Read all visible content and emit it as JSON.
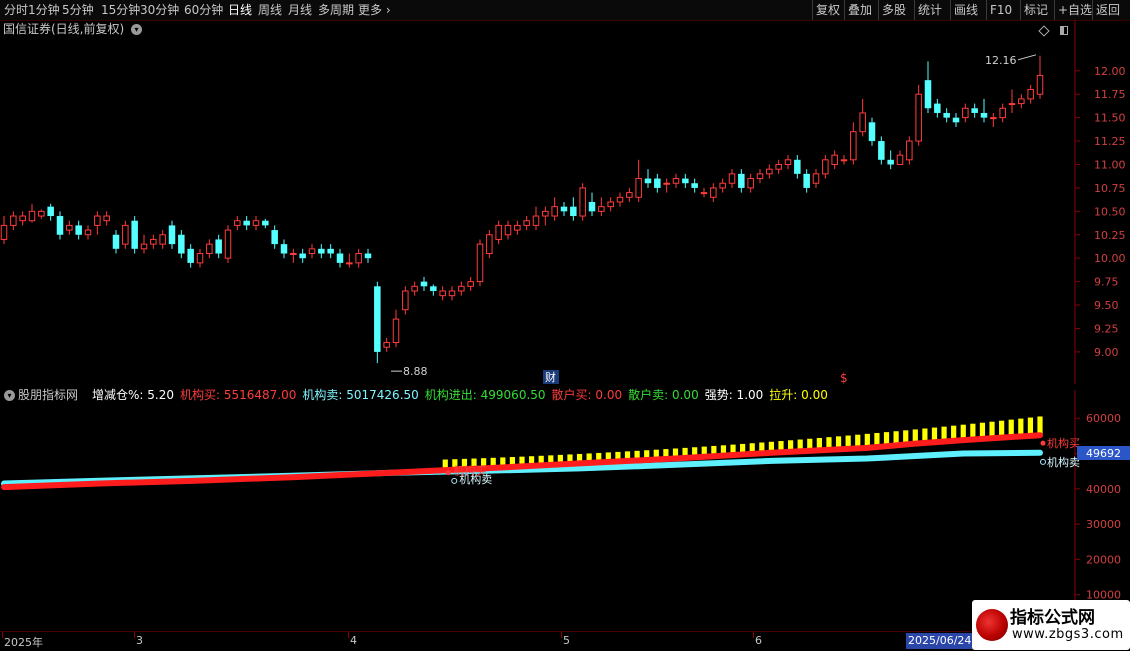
{
  "toolbar": {
    "left": [
      "分时",
      "1分钟",
      "5分钟",
      "15分钟",
      "30分钟",
      "60分钟",
      "日线",
      "周线",
      "月线",
      "多周期",
      "更多"
    ],
    "active": "日线",
    "right": [
      "复权",
      "叠加",
      "多股",
      "统计",
      "画线",
      "F10",
      "标记",
      "+自选",
      "返回"
    ]
  },
  "stock": {
    "title": "国信证券(日线,前复权)"
  },
  "price_chart": {
    "high_label": "12.16",
    "low_label": "8.88",
    "marker_cai": "财",
    "marker_s": "$"
  },
  "indicator": {
    "name": "股朋指标网",
    "items": [
      {
        "label": "增减仓%:",
        "value": "5.20",
        "color": "#ffffff"
      },
      {
        "label": "机构买:",
        "value": "5516487.00",
        "color": "#ff3c3c"
      },
      {
        "label": "机构卖:",
        "value": "5017426.50",
        "color": "#7ff5ff"
      },
      {
        "label": "机构进出:",
        "value": "499060.50",
        "color": "#33dd33"
      },
      {
        "label": "散户买:",
        "value": "0.00",
        "color": "#ff3c3c"
      },
      {
        "label": "散户卖:",
        "value": "0.00",
        "color": "#33dd33"
      },
      {
        "label": "强势:",
        "value": "1.00",
        "color": "#ffffff"
      },
      {
        "label": "拉升:",
        "value": "0.00",
        "color": "#ffff00"
      }
    ],
    "buy_label": "机构买",
    "sell_label": "机构卖",
    "value_box": "49692"
  },
  "date_axis": {
    "labels": [
      "2025年",
      "3",
      "4",
      "5",
      "6"
    ],
    "cursor_date": "2025/06/24"
  },
  "watermark": {
    "title": "指标公式网",
    "url": "www.zbgs3.com"
  },
  "colors": {
    "up": "#ff3c3c",
    "down": "#54ffff",
    "buy": "#ff1c1c",
    "sell": "#5ef0ff",
    "bar": "#ffff00",
    "axis": "#d04040"
  },
  "chart_data": [
    {
      "type": "candlestick",
      "title": "国信证券(日线,前复权)",
      "ylim": [
        8.7,
        12.35
      ],
      "yticks": [
        9.0,
        9.25,
        9.5,
        9.75,
        10.0,
        10.25,
        10.5,
        10.75,
        11.0,
        11.25,
        11.5,
        11.75,
        12.0
      ],
      "annotations": [
        {
          "text": "12.16",
          "value": 12.16
        },
        {
          "text": "8.88",
          "value": 8.88
        }
      ],
      "candles": [
        [
          10.2,
          10.35,
          10.45,
          10.15
        ],
        [
          10.35,
          10.45,
          10.5,
          10.3
        ],
        [
          10.4,
          10.45,
          10.5,
          10.35
        ],
        [
          10.4,
          10.5,
          10.58,
          10.38
        ],
        [
          10.45,
          10.5,
          10.52,
          10.42
        ],
        [
          10.55,
          10.45,
          10.58,
          10.4
        ],
        [
          10.45,
          10.25,
          10.5,
          10.2
        ],
        [
          10.3,
          10.35,
          10.4,
          10.25
        ],
        [
          10.35,
          10.25,
          10.4,
          10.2
        ],
        [
          10.25,
          10.3,
          10.35,
          10.2
        ],
        [
          10.35,
          10.45,
          10.5,
          10.25
        ],
        [
          10.4,
          10.45,
          10.5,
          10.35
        ],
        [
          10.25,
          10.1,
          10.3,
          10.05
        ],
        [
          10.15,
          10.35,
          10.4,
          10.1
        ],
        [
          10.4,
          10.1,
          10.45,
          10.05
        ],
        [
          10.1,
          10.15,
          10.25,
          10.05
        ],
        [
          10.15,
          10.2,
          10.25,
          10.1
        ],
        [
          10.15,
          10.25,
          10.3,
          10.1
        ],
        [
          10.35,
          10.15,
          10.4,
          10.1
        ],
        [
          10.25,
          10.05,
          10.3,
          10.0
        ],
        [
          10.1,
          9.95,
          10.15,
          9.9
        ],
        [
          9.95,
          10.05,
          10.1,
          9.9
        ],
        [
          10.05,
          10.15,
          10.2,
          10.0
        ],
        [
          10.2,
          10.05,
          10.25,
          10.0
        ],
        [
          10.0,
          10.3,
          10.35,
          9.95
        ],
        [
          10.35,
          10.4,
          10.45,
          10.3
        ],
        [
          10.4,
          10.35,
          10.45,
          10.3
        ],
        [
          10.35,
          10.4,
          10.45,
          10.3
        ],
        [
          10.4,
          10.35,
          10.42,
          10.32
        ],
        [
          10.3,
          10.15,
          10.35,
          10.1
        ],
        [
          10.15,
          10.05,
          10.2,
          10.0
        ],
        [
          10.05,
          10.05,
          10.1,
          9.95
        ],
        [
          10.05,
          10.0,
          10.1,
          9.95
        ],
        [
          10.05,
          10.1,
          10.15,
          10.0
        ],
        [
          10.1,
          10.05,
          10.15,
          10.0
        ],
        [
          10.1,
          10.05,
          10.15,
          10.0
        ],
        [
          10.05,
          9.95,
          10.1,
          9.9
        ],
        [
          9.95,
          9.95,
          10.05,
          9.9
        ],
        [
          9.95,
          10.05,
          10.1,
          9.9
        ],
        [
          10.05,
          10.0,
          10.1,
          9.95
        ],
        [
          9.7,
          9.0,
          9.75,
          8.88
        ],
        [
          9.05,
          9.1,
          9.15,
          9.0
        ],
        [
          9.1,
          9.35,
          9.45,
          9.05
        ],
        [
          9.45,
          9.65,
          9.7,
          9.4
        ],
        [
          9.65,
          9.7,
          9.75,
          9.6
        ],
        [
          9.75,
          9.7,
          9.8,
          9.65
        ],
        [
          9.7,
          9.65,
          9.72,
          9.6
        ],
        [
          9.6,
          9.65,
          9.7,
          9.55
        ],
        [
          9.6,
          9.65,
          9.7,
          9.55
        ],
        [
          9.65,
          9.7,
          9.75,
          9.6
        ],
        [
          9.7,
          9.75,
          9.8,
          9.65
        ],
        [
          9.75,
          10.15,
          10.2,
          9.7
        ],
        [
          10.05,
          10.25,
          10.3,
          10.0
        ],
        [
          10.2,
          10.35,
          10.4,
          10.15
        ],
        [
          10.25,
          10.35,
          10.4,
          10.2
        ],
        [
          10.3,
          10.35,
          10.4,
          10.25
        ],
        [
          10.35,
          10.4,
          10.45,
          10.3
        ],
        [
          10.35,
          10.45,
          10.55,
          10.3
        ],
        [
          10.45,
          10.5,
          10.55,
          10.35
        ],
        [
          10.45,
          10.55,
          10.65,
          10.4
        ],
        [
          10.55,
          10.5,
          10.6,
          10.45
        ],
        [
          10.55,
          10.45,
          10.65,
          10.4
        ],
        [
          10.45,
          10.75,
          10.8,
          10.4
        ],
        [
          10.6,
          10.5,
          10.7,
          10.45
        ],
        [
          10.5,
          10.55,
          10.65,
          10.45
        ],
        [
          10.55,
          10.6,
          10.65,
          10.5
        ],
        [
          10.6,
          10.65,
          10.7,
          10.55
        ],
        [
          10.65,
          10.7,
          10.75,
          10.6
        ],
        [
          10.65,
          10.85,
          11.05,
          10.6
        ],
        [
          10.85,
          10.8,
          10.95,
          10.75
        ],
        [
          10.85,
          10.75,
          10.9,
          10.7
        ],
        [
          10.8,
          10.8,
          10.85,
          10.7
        ],
        [
          10.8,
          10.85,
          10.9,
          10.75
        ],
        [
          10.85,
          10.8,
          10.9,
          10.75
        ],
        [
          10.8,
          10.75,
          10.85,
          10.7
        ],
        [
          10.7,
          10.7,
          10.75,
          10.65
        ],
        [
          10.65,
          10.75,
          10.8,
          10.6
        ],
        [
          10.75,
          10.8,
          10.85,
          10.7
        ],
        [
          10.8,
          10.9,
          10.95,
          10.75
        ],
        [
          10.9,
          10.75,
          10.95,
          10.7
        ],
        [
          10.75,
          10.85,
          10.9,
          10.7
        ],
        [
          10.85,
          10.9,
          10.95,
          10.8
        ],
        [
          10.9,
          10.95,
          11.0,
          10.85
        ],
        [
          10.95,
          11.0,
          11.05,
          10.9
        ],
        [
          11.0,
          11.05,
          11.1,
          10.95
        ],
        [
          11.05,
          10.9,
          11.1,
          10.85
        ],
        [
          10.9,
          10.75,
          10.95,
          10.7
        ],
        [
          10.8,
          10.9,
          10.95,
          10.75
        ],
        [
          10.9,
          11.05,
          11.1,
          10.85
        ],
        [
          11.0,
          11.1,
          11.15,
          10.95
        ],
        [
          11.05,
          11.05,
          11.1,
          11.0
        ],
        [
          11.05,
          11.35,
          11.45,
          11.0
        ],
        [
          11.35,
          11.55,
          11.7,
          11.3
        ],
        [
          11.45,
          11.25,
          11.5,
          11.2
        ],
        [
          11.25,
          11.05,
          11.3,
          11.0
        ],
        [
          11.05,
          11.0,
          11.15,
          10.95
        ],
        [
          11.0,
          11.1,
          11.15,
          11.0
        ],
        [
          11.05,
          11.25,
          11.3,
          11.0
        ],
        [
          11.25,
          11.75,
          11.85,
          11.2
        ],
        [
          11.9,
          11.6,
          12.1,
          11.55
        ],
        [
          11.65,
          11.55,
          11.7,
          11.5
        ],
        [
          11.55,
          11.5,
          11.6,
          11.45
        ],
        [
          11.5,
          11.45,
          11.55,
          11.4
        ],
        [
          11.5,
          11.6,
          11.65,
          11.45
        ],
        [
          11.6,
          11.55,
          11.65,
          11.5
        ],
        [
          11.55,
          11.5,
          11.7,
          11.45
        ],
        [
          11.5,
          11.5,
          11.55,
          11.4
        ],
        [
          11.5,
          11.6,
          11.65,
          11.45
        ],
        [
          11.65,
          11.65,
          11.8,
          11.55
        ],
        [
          11.65,
          11.7,
          11.75,
          11.6
        ],
        [
          11.7,
          11.8,
          11.85,
          11.65
        ],
        [
          11.75,
          11.95,
          12.16,
          11.7
        ]
      ]
    },
    {
      "type": "line",
      "title": "股朋指标网",
      "ylim": [
        0,
        68000
      ],
      "yticks": [
        10000,
        20000,
        30000,
        40000,
        50000,
        60000
      ],
      "series": [
        {
          "name": "机构买",
          "color": "#ff1c1c",
          "x": [
            0,
            10,
            20,
            30,
            40,
            50,
            60,
            70,
            80,
            90,
            95,
            100,
            108
          ],
          "values": [
            40500,
            41500,
            42300,
            43300,
            44500,
            45800,
            47200,
            48600,
            50200,
            51600,
            52800,
            53800,
            55200
          ]
        },
        {
          "name": "机构卖",
          "color": "#5ef0ff",
          "x": [
            0,
            10,
            20,
            30,
            40,
            50,
            60,
            70,
            80,
            90,
            95,
            100,
            108
          ],
          "values": [
            41500,
            42300,
            43000,
            43700,
            44500,
            45100,
            45800,
            46800,
            47900,
            48600,
            49300,
            50000,
            50200
          ]
        }
      ],
      "bars": {
        "color": "#ffff00",
        "x_start": 46,
        "x_end": 108,
        "top_start": 48300,
        "top_end": 60500
      }
    }
  ]
}
